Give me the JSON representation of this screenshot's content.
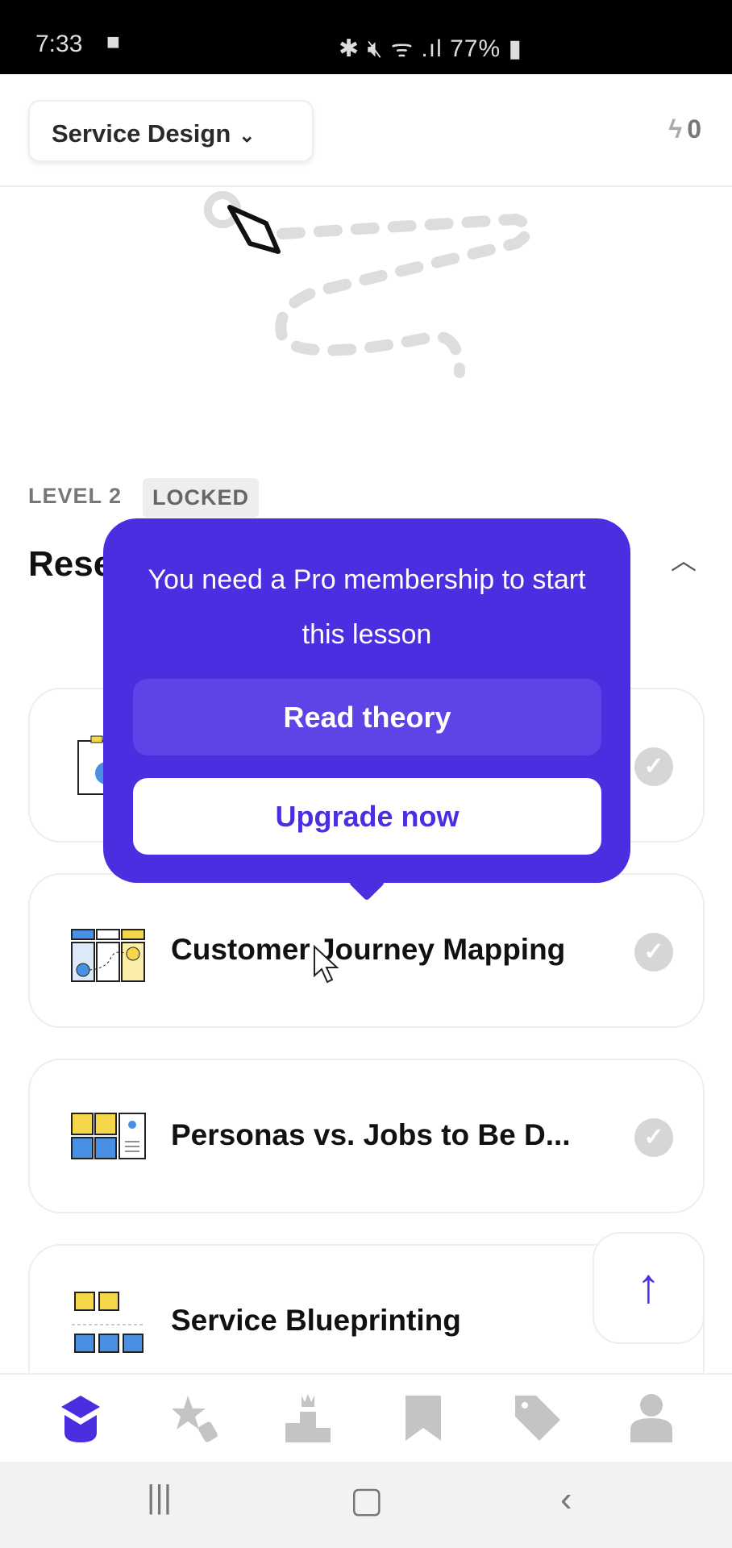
{
  "status_bar": {
    "time": "7:33",
    "battery": "77%",
    "icons": [
      "video-icon",
      "bluetooth-icon",
      "mute-icon",
      "wifi-icon",
      "signal-icon",
      "battery-icon"
    ]
  },
  "header": {
    "course": "Service Design",
    "streak": "0"
  },
  "section": {
    "level": "LEVEL 2",
    "badge": "LOCKED",
    "title": "Research Design"
  },
  "popup": {
    "message": "You need a Pro membership to start this lesson",
    "read": "Read theory",
    "upgrade": "Upgrade now"
  },
  "lessons": [
    {
      "title": ""
    },
    {
      "title": "Customer Journey Mapping"
    },
    {
      "title": "Personas vs. Jobs to Be D..."
    },
    {
      "title": "Service Blueprinting"
    }
  ],
  "bottom_nav": [
    "learn",
    "achievements",
    "leaderboard",
    "saved",
    "pricing",
    "profile"
  ],
  "colors": {
    "accent": "#4b2ee0",
    "inactive": "#c4c4c4"
  }
}
